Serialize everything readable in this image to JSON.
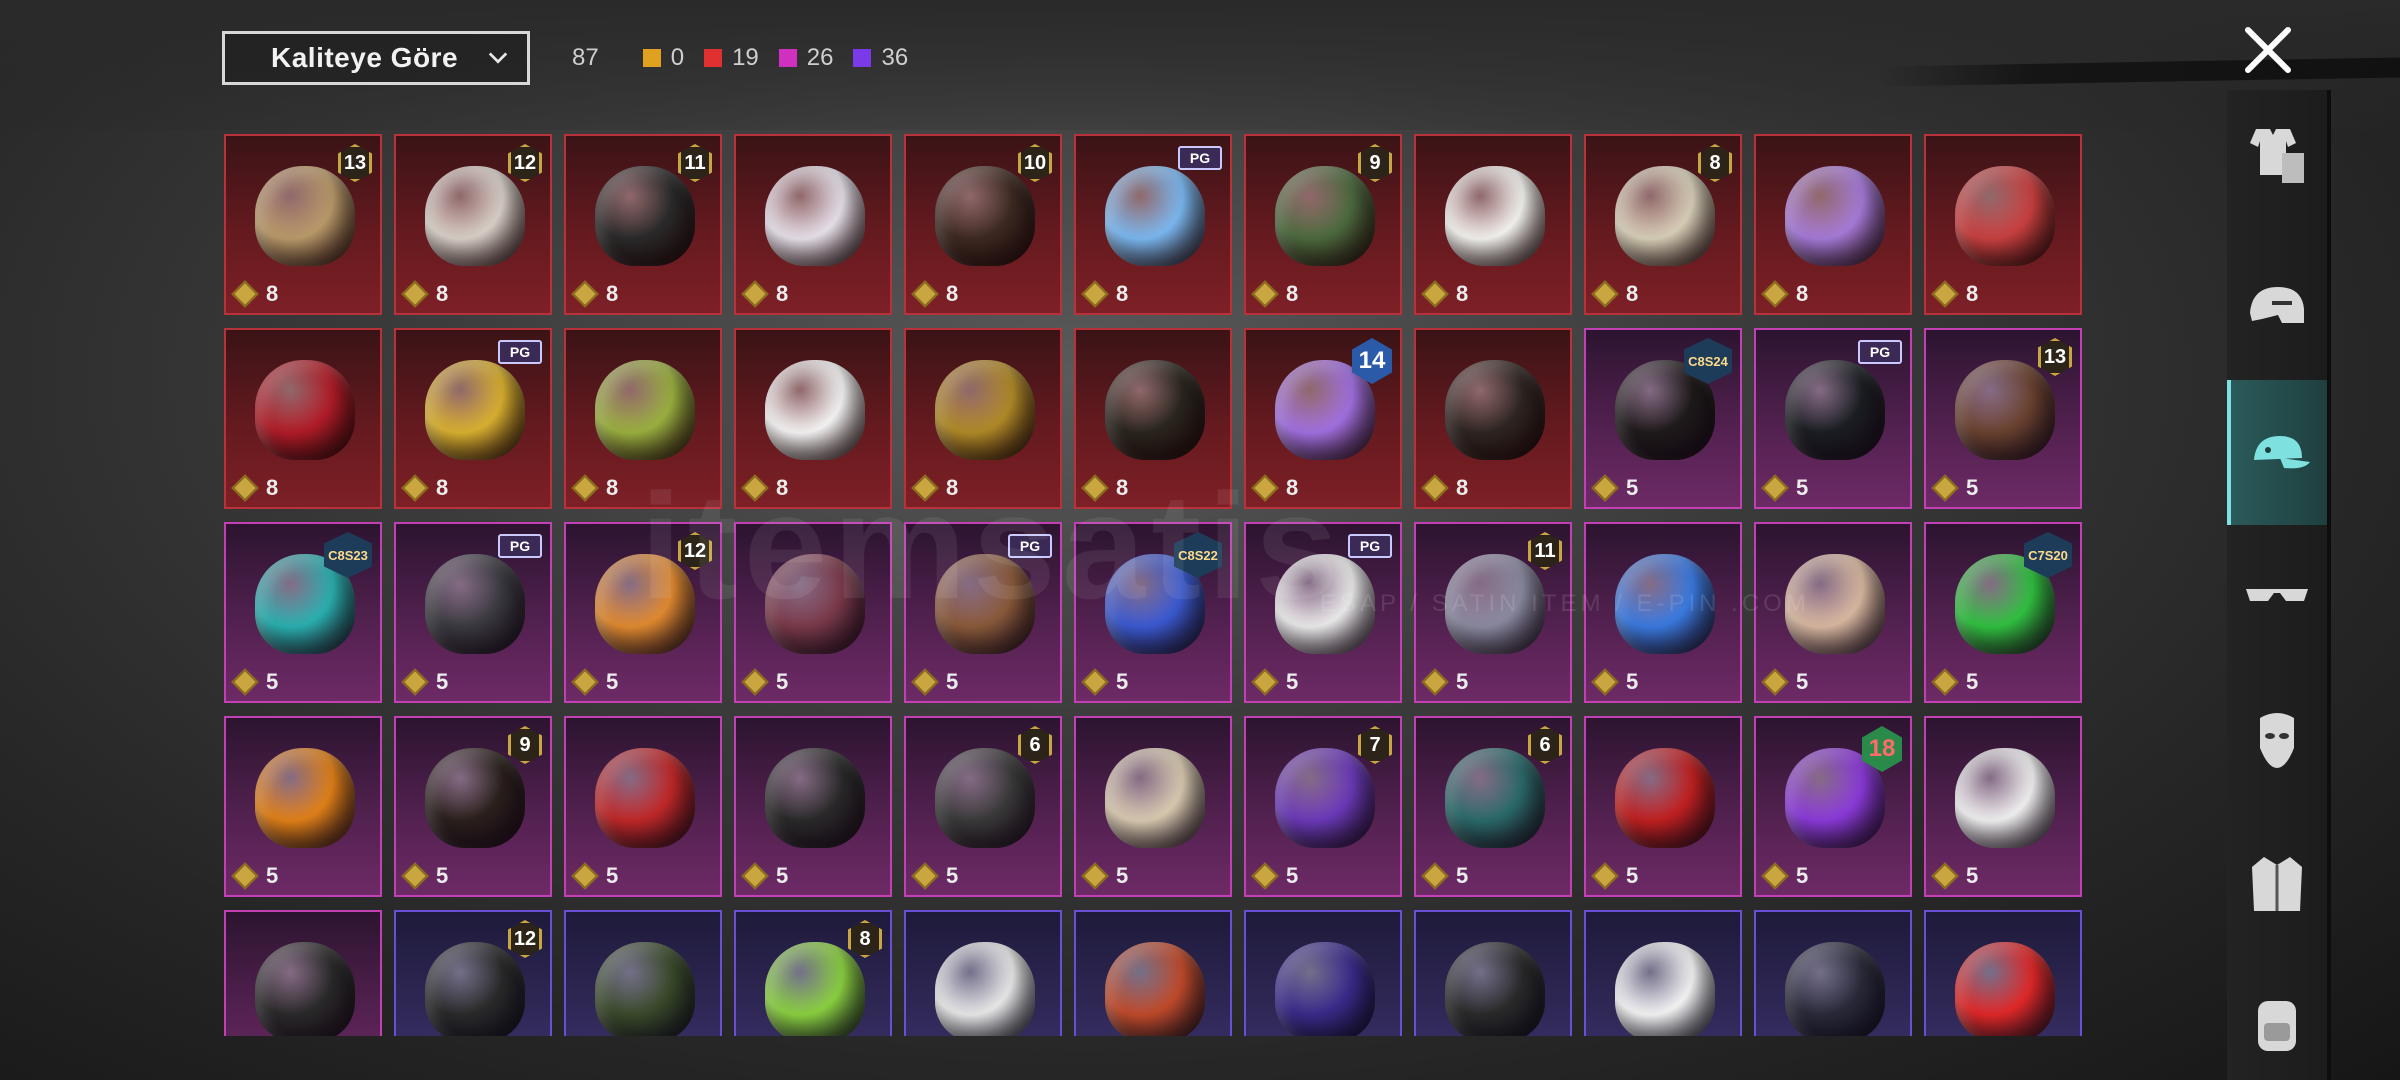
{
  "sort": {
    "label": "Kaliteye Göre",
    "icon": "chevron-down-icon"
  },
  "stats": {
    "total": "87",
    "counts": [
      {
        "value": "0",
        "color": "#e0a020"
      },
      {
        "value": "19",
        "color": "#e03030"
      },
      {
        "value": "26",
        "color": "#d030c0"
      },
      {
        "value": "36",
        "color": "#7a3ae8"
      }
    ]
  },
  "close_icon": "close-icon",
  "watermark": {
    "text": "itemsatis",
    "sub": "ESAP / SATIN ITEM / E-PIN .COM"
  },
  "sidebar": [
    {
      "name": "outfit-icon"
    },
    {
      "name": "helmet-icon"
    },
    {
      "name": "cap-icon",
      "active": true
    },
    {
      "name": "glasses-icon"
    },
    {
      "name": "mask-icon"
    },
    {
      "name": "jacket-icon"
    },
    {
      "name": "backpack-icon"
    }
  ],
  "items": [
    {
      "q": "red",
      "badge": "13",
      "btype": "num",
      "cost": "8",
      "color": "#b99a6a"
    },
    {
      "q": "red",
      "badge": "12",
      "btype": "num",
      "cost": "8",
      "color": "#d8d0c8"
    },
    {
      "q": "red",
      "badge": "11",
      "btype": "num",
      "cost": "8",
      "color": "#2a2a2a"
    },
    {
      "q": "red",
      "badge": "",
      "btype": "",
      "cost": "8",
      "color": "#e6e0ea"
    },
    {
      "q": "red",
      "badge": "10",
      "btype": "num",
      "cost": "8",
      "color": "#3d2a22"
    },
    {
      "q": "red",
      "badge": "PG",
      "btype": "pgx",
      "cost": "8",
      "color": "#7ab8f0"
    },
    {
      "q": "red",
      "badge": "9",
      "btype": "num",
      "cost": "8",
      "color": "#4c6a3e"
    },
    {
      "q": "red",
      "badge": "",
      "btype": "",
      "cost": "8",
      "color": "#f2f2ee"
    },
    {
      "q": "red",
      "badge": "8",
      "btype": "num",
      "cost": "8",
      "color": "#d7cfb8"
    },
    {
      "q": "red",
      "badge": "",
      "btype": "",
      "cost": "8",
      "color": "#a57ad8"
    },
    {
      "q": "red",
      "badge": "",
      "btype": "",
      "cost": "8",
      "color": "#c84040"
    },
    {
      "q": "red",
      "badge": "",
      "btype": "",
      "cost": "8",
      "color": "#b01c28"
    },
    {
      "q": "red",
      "badge": "PG",
      "btype": "pgx",
      "cost": "8",
      "color": "#d8b030"
    },
    {
      "q": "red",
      "badge": "",
      "btype": "",
      "cost": "8",
      "color": "#9ab040"
    },
    {
      "q": "red",
      "badge": "",
      "btype": "",
      "cost": "8",
      "color": "#f4f4f4"
    },
    {
      "q": "red",
      "badge": "",
      "btype": "",
      "cost": "8",
      "color": "#b08a28"
    },
    {
      "q": "red",
      "badge": "",
      "btype": "",
      "cost": "8",
      "color": "#2a261e"
    },
    {
      "q": "red",
      "badge": "14",
      "btype": "big",
      "cost": "8",
      "color": "#a070e0"
    },
    {
      "q": "red",
      "badge": "",
      "btype": "",
      "cost": "8",
      "color": "#2e2622"
    },
    {
      "q": "pink",
      "badge": "C8S24",
      "btype": "season",
      "cost": "5",
      "color": "#1e1a1a"
    },
    {
      "q": "pink",
      "badge": "PG",
      "btype": "pgx",
      "cost": "5",
      "color": "#1a1e22"
    },
    {
      "q": "pink",
      "badge": "13",
      "btype": "num",
      "cost": "5",
      "color": "#6a4230"
    },
    {
      "q": "pink",
      "badge": "C8S23",
      "btype": "season",
      "cost": "5",
      "color": "#2ab0b0"
    },
    {
      "q": "pink",
      "badge": "PG",
      "btype": "pgx",
      "cost": "5",
      "color": "#3a3a40"
    },
    {
      "q": "pink",
      "badge": "12",
      "btype": "num",
      "cost": "5",
      "color": "#e08a30"
    },
    {
      "q": "pink",
      "badge": "",
      "btype": "",
      "cost": "5",
      "color": "#7a3a4a"
    },
    {
      "q": "pink",
      "badge": "PG",
      "btype": "pgx",
      "cost": "5",
      "color": "#8a5a3a"
    },
    {
      "q": "pink",
      "badge": "C8S22",
      "btype": "season",
      "cost": "5",
      "color": "#3a5ad0"
    },
    {
      "q": "pink",
      "badge": "PG",
      "btype": "pgx",
      "cost": "5",
      "color": "#eaeaea"
    },
    {
      "q": "pink",
      "badge": "11",
      "btype": "num",
      "cost": "5",
      "color": "#8a8aa0"
    },
    {
      "q": "pink",
      "badge": "",
      "btype": "",
      "cost": "5",
      "color": "#3a7ae0"
    },
    {
      "q": "pink",
      "badge": "",
      "btype": "",
      "cost": "5",
      "color": "#d8b8a0"
    },
    {
      "q": "pink",
      "badge": "C7S20",
      "btype": "season",
      "cost": "5",
      "color": "#30c040"
    },
    {
      "q": "pink",
      "badge": "",
      "btype": "",
      "cost": "5",
      "color": "#e08018"
    },
    {
      "q": "pink",
      "badge": "9",
      "btype": "num",
      "cost": "5",
      "color": "#2a201c"
    },
    {
      "q": "pink",
      "badge": "",
      "btype": "",
      "cost": "5",
      "color": "#c02828"
    },
    {
      "q": "pink",
      "badge": "",
      "btype": "",
      "cost": "5",
      "color": "#2a2a2a"
    },
    {
      "q": "pink",
      "badge": "6",
      "btype": "num",
      "cost": "5",
      "color": "#3a3a3a"
    },
    {
      "q": "pink",
      "badge": "",
      "btype": "",
      "cost": "5",
      "color": "#d8cab0"
    },
    {
      "q": "pink",
      "badge": "7",
      "btype": "num",
      "cost": "5",
      "color": "#6a3ab8"
    },
    {
      "q": "pink",
      "badge": "6",
      "btype": "num",
      "cost": "5",
      "color": "#2a6a6a"
    },
    {
      "q": "pink",
      "badge": "",
      "btype": "",
      "cost": "5",
      "color": "#c02020"
    },
    {
      "q": "pink",
      "badge": "18",
      "btype": "big green",
      "cost": "5",
      "color": "#8a3ad8"
    },
    {
      "q": "pink",
      "badge": "",
      "btype": "",
      "cost": "5",
      "color": "#f0f0f0"
    },
    {
      "q": "pink",
      "badge": "",
      "btype": "",
      "cost": "",
      "color": "#2a2a2a"
    },
    {
      "q": "purple",
      "badge": "12",
      "btype": "num",
      "cost": "",
      "color": "#2a2a2a"
    },
    {
      "q": "purple",
      "badge": "",
      "btype": "",
      "cost": "",
      "color": "#3a4a2a"
    },
    {
      "q": "purple",
      "badge": "8",
      "btype": "num",
      "cost": "",
      "color": "#8ad040"
    },
    {
      "q": "purple",
      "badge": "",
      "btype": "",
      "cost": "",
      "color": "#e8e8e8"
    },
    {
      "q": "purple",
      "badge": "",
      "btype": "",
      "cost": "",
      "color": "#c04a2a"
    },
    {
      "q": "purple",
      "badge": "",
      "btype": "",
      "cost": "",
      "color": "#3a2a8a"
    },
    {
      "q": "purple",
      "badge": "",
      "btype": "",
      "cost": "",
      "color": "#2a2a2a"
    },
    {
      "q": "purple",
      "badge": "",
      "btype": "",
      "cost": "",
      "color": "#f4f4f4"
    },
    {
      "q": "purple",
      "badge": "",
      "btype": "",
      "cost": "",
      "color": "#2a2a3a"
    },
    {
      "q": "purple",
      "badge": "",
      "btype": "",
      "cost": "",
      "color": "#e02828"
    }
  ]
}
